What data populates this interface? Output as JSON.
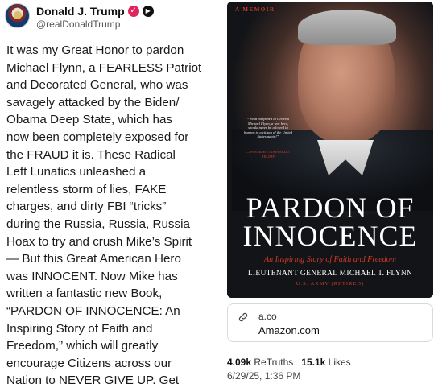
{
  "author": {
    "name": "Donald J. Trump",
    "handle": "@realDonaldTrump"
  },
  "post": {
    "lines": [
      "It was my Great Honor to pardon",
      "Michael Flynn, a FEARLESS Patriot",
      "and Decorated General, who was",
      "savagely attacked by the Biden/",
      "Obama Deep State, which has",
      "now been completely exposed for",
      "the FRAUD it is. These Radical",
      "Left Lunatics unleashed a",
      "relentless storm of lies, FAKE",
      "charges, and dirty FBI “tricks”",
      "during the Russia, Russia, Russia",
      "Hoax to try and crush Mike’s Spirit",
      "— But this Great American Hero",
      "was INNOCENT. Now Mike has",
      "written a fantastic new Book,",
      "“PARDON OF INNOCENCE: An",
      "Inspiring Story of Faith and",
      "Freedom,” which will greatly",
      "encourage Citizens across our",
      "Nation to NEVER GIVE UP. Get"
    ]
  },
  "book": {
    "label": "A MEMOIR",
    "quote": "“What happened to General Michael Flynn, a war hero, should never be allowed to happen to a citizen of the United States again!”",
    "quote_author": "—PRESIDENT DONALD J. TRUMP",
    "title_line1": "PARDON OF",
    "title_line2": "INNOCENCE",
    "subtitle": "An Inspiring Story of Faith and Freedom",
    "author": "LIEUTENANT GENERAL MICHAEL T. FLYNN",
    "rank": "U.S. ARMY (RETIRED)"
  },
  "link": {
    "domain": "a.co",
    "title": "Amazon.com"
  },
  "stats": {
    "retruths_count": "4.09k",
    "retruths_label": "ReTruths",
    "likes_count": "15.1k",
    "likes_label": "Likes",
    "timestamp": "6/29/25, 1:36 PM"
  },
  "colors": {
    "verified": "#e0245e",
    "book_accent": "#d23a2a",
    "book_bg": "#0d0f12"
  }
}
